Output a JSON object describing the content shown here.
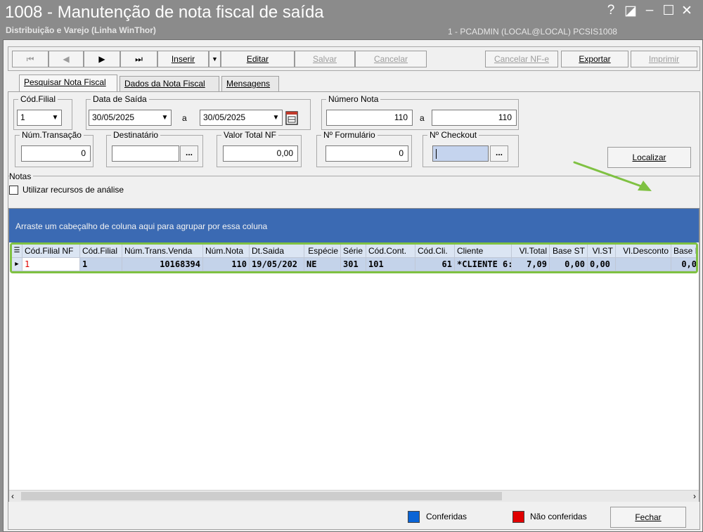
{
  "window": {
    "title": "1008 - Manutenção de nota fiscal de saída",
    "subtitle": "Distribuição e Varejo (Linha WinThor)",
    "user_info": "1 - PCADMIN (LOCAL@LOCAL)   PCSIS1008",
    "controls": {
      "help": "?",
      "restore": "◪",
      "minimize": "–",
      "maximize": "☐",
      "close": "✕"
    }
  },
  "toolbar": {
    "first": "⏮",
    "prev": "◀",
    "next": "▶",
    "last": "⏭",
    "inserir": "Inserir",
    "inserir_dropdown": "▼",
    "editar": "Editar",
    "salvar": "Salvar",
    "cancelar": "Cancelar",
    "cancelar_nfe": "Cancelar NF-e",
    "exportar": "Exportar",
    "imprimir": "Imprimir"
  },
  "tabs": [
    "Pesquisar Nota Fiscal",
    "Dados da Nota Fiscal",
    "Mensagens"
  ],
  "filters": {
    "cod_filial": {
      "label": "Cód.Filial",
      "value": "1"
    },
    "data_saida": {
      "label": "Data de Saída",
      "from": "30/05/2025",
      "sep": "a",
      "to": "30/05/2025"
    },
    "numero_nota": {
      "label": "Número Nota",
      "from": "110",
      "sep": "a",
      "to": "110"
    },
    "num_transacao": {
      "label": "Núm.Transação",
      "value": "0"
    },
    "destinatario": {
      "label": "Destinatário",
      "value": "",
      "btn": "..."
    },
    "valor_total": {
      "label": "Valor Total NF",
      "value": "0,00"
    },
    "formulario": {
      "label": "Nº Formulário",
      "value": "0"
    },
    "checkout": {
      "label": "Nº Checkout",
      "value": "",
      "btn": "..."
    },
    "localizar": "Localizar"
  },
  "notas": {
    "label": "Notas",
    "analise": "Utilizar recursos de análise",
    "group_hint": "Arraste um cabeçalho de coluna aqui para agrupar por essa coluna"
  },
  "grid": {
    "columns": [
      "Cód.Filial NF",
      "Cód.Filial",
      "Núm.Trans.Venda",
      "Núm.Nota",
      "Dt.Saida",
      "Espécie",
      "Série",
      "Cód.Cont.",
      "Cód.Cli.",
      "Cliente",
      "Vl.Total",
      "Base ST",
      "Vl.ST",
      "Vl.Desconto",
      "Base I"
    ],
    "rows": [
      [
        "1",
        "1",
        "10168394",
        "110",
        "19/05/202",
        "NE",
        "301",
        "101",
        "61",
        "*CLIENTE 6:",
        "7,09",
        "0,00",
        "0,00",
        "",
        "0,0"
      ]
    ]
  },
  "legend": {
    "conferidas": "Conferidas",
    "nao_conferidas": "Não conferidas",
    "conferidas_color": "#0a64d6",
    "nao_conferidas_color": "#e00000"
  },
  "fechar": "Fechar",
  "colors": {
    "accent_bar": "#3b6ab3",
    "highlight_green": "#7fc142"
  }
}
